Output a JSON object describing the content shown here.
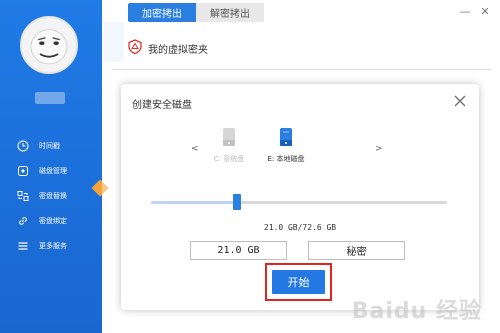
{
  "tabs": [
    {
      "label": "加密拷出",
      "active": true
    },
    {
      "label": "解密拷出",
      "active": false
    }
  ],
  "vault": {
    "label": "我的虚拟密夹",
    "icon": "shield-icon"
  },
  "sidebar": {
    "items": [
      {
        "label": "时间戳",
        "icon": "clock-icon"
      },
      {
        "label": "磁盘管理",
        "icon": "disk-icon"
      },
      {
        "label": "密盘替换",
        "icon": "swap-icon"
      },
      {
        "label": "密盘绑定",
        "icon": "link-icon"
      },
      {
        "label": "更多服务",
        "icon": "menu-icon"
      }
    ]
  },
  "dialog": {
    "title": "创建安全磁盘",
    "prev_arrow": "<",
    "next_arrow": ">",
    "drives": [
      {
        "label": "C: 系统盘",
        "selected": false,
        "icon": "drive-icon"
      },
      {
        "label": "E: 本地磁盘",
        "selected": true,
        "icon": "drive-icon"
      }
    ],
    "slider": {
      "value_gb": 21.0,
      "max_gb": 72.6
    },
    "size_readout": "21.0 GB/72.6 GB",
    "size_value": "21.0 GB",
    "password_value": "秘密",
    "start_label": "开始"
  },
  "window": {
    "minimize": "—",
    "close": "✕"
  },
  "watermark": "Baidu 经验",
  "colors": {
    "accent": "#2b7fe0",
    "sidebar": "#1f7be6",
    "highlight": "#e0261f"
  }
}
